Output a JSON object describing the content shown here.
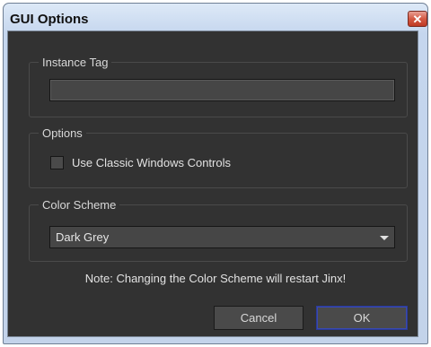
{
  "window": {
    "title": "GUI Options",
    "close_glyph": "✕"
  },
  "instance_tag": {
    "legend": "Instance Tag",
    "value": ""
  },
  "options": {
    "legend": "Options",
    "classic_controls_label": "Use Classic Windows Controls",
    "classic_controls_checked": false
  },
  "color_scheme": {
    "legend": "Color Scheme",
    "selected": "Dark Grey"
  },
  "note": "Note: Changing the Color Scheme will restart Jinx!",
  "buttons": {
    "cancel": "Cancel",
    "ok": "OK"
  },
  "colors": {
    "client_background": "#323232",
    "field_background": "#464646",
    "default_button_border": "#2a3a9a"
  },
  "icons": {
    "close": "close-icon",
    "dropdown": "chevron-down-icon"
  }
}
